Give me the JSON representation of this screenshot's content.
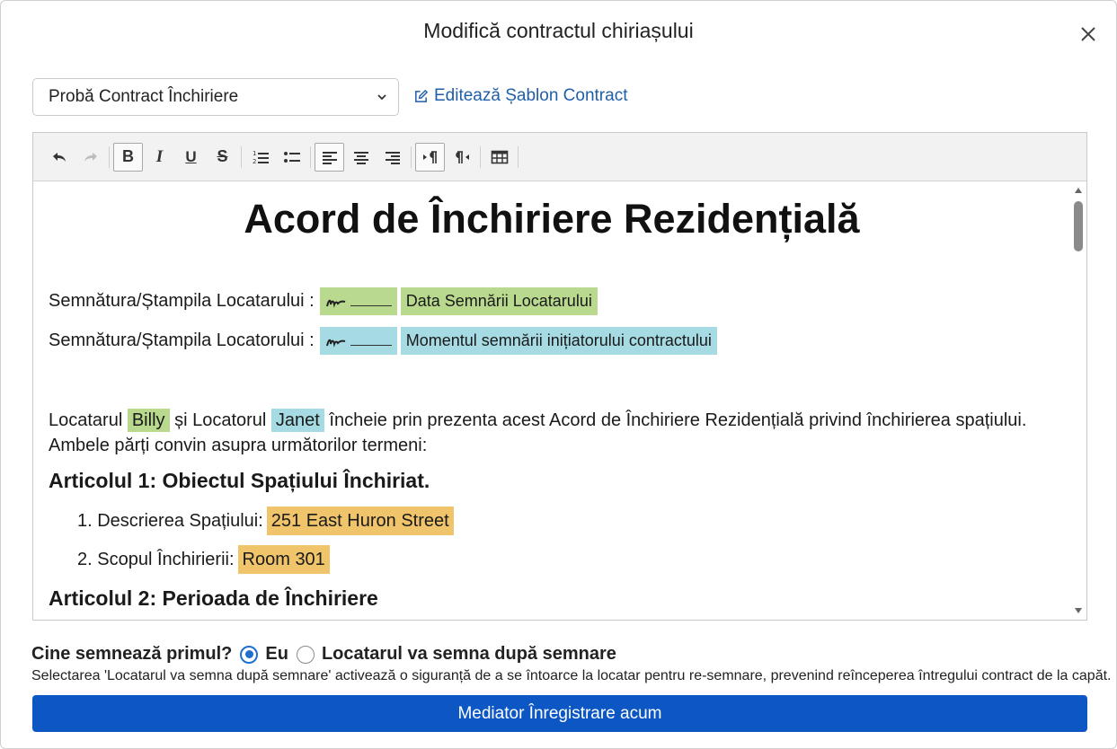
{
  "dialog": {
    "title": "Modifică contractul chiriașului",
    "close_icon": "close-icon"
  },
  "template_select": {
    "selected": "Probă Contract Închiriere",
    "icon": "chevron-down-icon"
  },
  "edit_template": {
    "label": "Editează Șablon Contract",
    "icon": "edit-icon"
  },
  "toolbar": {
    "items": [
      "undo-icon",
      "redo-icon",
      "bold-icon",
      "italic-icon",
      "underline-icon",
      "strikethrough-icon",
      "ordered-list-icon",
      "bullet-list-icon",
      "align-left-icon",
      "align-center-icon",
      "align-right-icon",
      "ltr-icon",
      "rtl-icon",
      "table-icon"
    ],
    "bold": "B",
    "italic": "I",
    "underline": "U",
    "strike": "S"
  },
  "document": {
    "title": "Acord de Închiriere Rezidențială",
    "tenant_sig_label": "Semnătura/Ștampila Locatarului :",
    "tenant_sig_date": "Data Semnării Locatarului",
    "landlord_sig_label": "Semnătura/Ștampila Locatorului :",
    "landlord_sig_date": "Momentul semnării inițiatorului contractului",
    "intro_prefix": "Locatarul",
    "tenant_name": "Billy",
    "intro_mid": "și Locatorul",
    "landlord_name": "Janet",
    "intro_suffix": "încheie prin prezenta acest Acord de Închiriere Rezidențială privind închirierea spațiului.",
    "intro_line2": "Ambele părți convin asupra următorilor termeni:",
    "article1": "Articolul 1: Obiectul Spațiului Închiriat.",
    "item1_label": "1. Descrierea Spațiului:",
    "item1_value": "251 East Huron Street",
    "item2_label": "2. Scopul Închirierii:",
    "item2_value": "Room 301",
    "article2": "Articolul 2: Perioada de Închiriere"
  },
  "signer": {
    "question": "Cine semnează primul?",
    "option_me": "Eu",
    "option_tenant": "Locatarul va semna după semnare",
    "selected": "Eu",
    "hint": "Selectarea 'Locatarul va semna după semnare' activează o siguranță de a se întoarce la locatar pentru re-semnare, prevenind reînceperea întregului contract de la capăt."
  },
  "primary_button": {
    "label": "Mediator Înregistrare acum"
  },
  "colors": {
    "primary": "#0d57c4",
    "link": "#1f5fa8",
    "highlight_green": "#b8d98e",
    "highlight_cyan": "#a7dbe4",
    "highlight_orange": "#f0c46a"
  }
}
